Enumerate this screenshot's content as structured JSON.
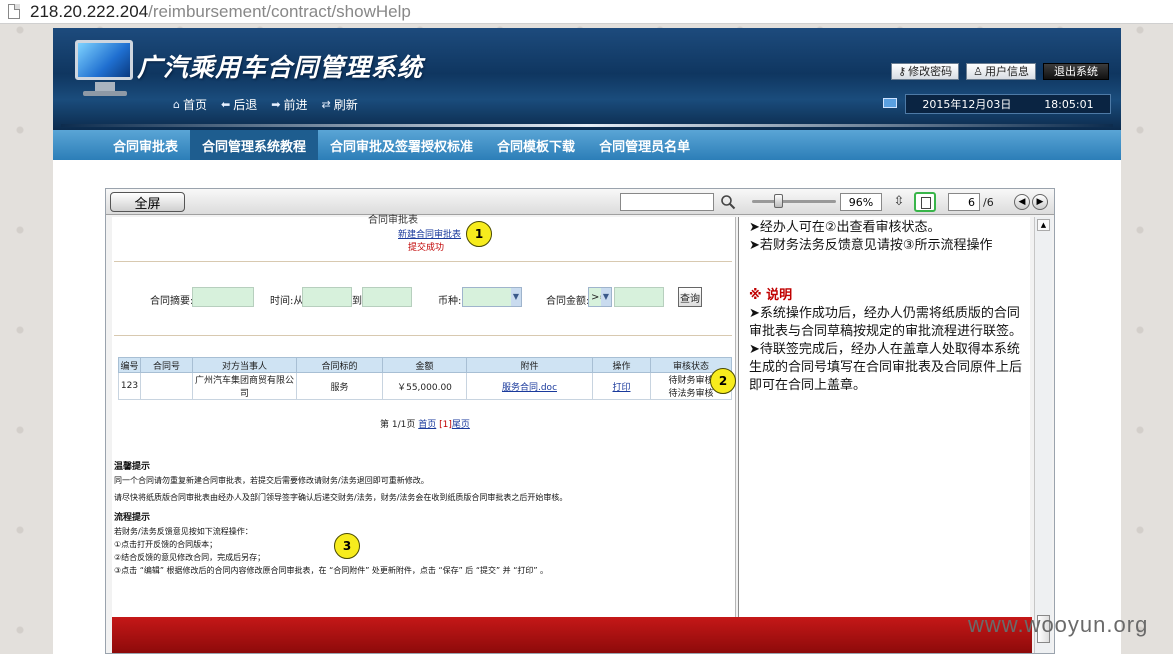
{
  "browser": {
    "url_host": "218.20.222.204",
    "url_path": "/reimbursement/contract/showHelp"
  },
  "header": {
    "title": "广汽乘用车合同管理系统",
    "actions": {
      "change_password": "修改密码",
      "user_info": "用户信息",
      "logout": "退出系统"
    },
    "nav": {
      "home": "首页",
      "back": "后退",
      "forward": "前进",
      "refresh": "刷新"
    },
    "date": "2015年12月03日",
    "time": "18:05:01"
  },
  "tabs": [
    {
      "label": "合同审批表"
    },
    {
      "label": "合同管理系统教程"
    },
    {
      "label": "合同审批及签署授权标准"
    },
    {
      "label": "合同模板下载"
    },
    {
      "label": "合同管理员名单"
    }
  ],
  "viewer": {
    "fullscreen_label": "全屏",
    "zoom": "96%",
    "page_current": "6",
    "page_total": "/6"
  },
  "doc": {
    "sub_title": "合同审批表",
    "new_link": "新建合同审批表",
    "success": "提交成功",
    "filters": {
      "summary_label": "合同摘要:",
      "time_label": "时间:从",
      "to_label": "到",
      "currency_label": "币种:",
      "amount_label": "合同金额:",
      "amount_op": ">=",
      "query_btn": "查询"
    },
    "table": {
      "headers": [
        "编号",
        "合同号",
        "对方当事人",
        "合同标的",
        "金额",
        "附件",
        "操作",
        "审核状态"
      ],
      "row": {
        "id": "123",
        "contract_no": "",
        "party": "广州汽车集团商贸有限公司",
        "subject": "服务",
        "amount": "￥55,000.00",
        "attachment": "服务合同.doc",
        "action": "打印",
        "status_1": "待财务审核",
        "status_2": "待法务审核"
      }
    },
    "pager": {
      "prefix": "第 1/1页",
      "first": "首页",
      "current": "[1]",
      "last": "尾页"
    },
    "tips": {
      "title": "温馨提示",
      "line1": "同一个合同请勿重复新建合同审批表，若提交后需要修改请财务/法务退回即可重新修改。",
      "line2": "请尽快将纸质版合同审批表由经办人及部门领导签字确认后递交财务/法务，财务/法务会在收到纸质版合同审批表之后开始审核。"
    },
    "process": {
      "title": "流程提示",
      "line1": "若财务/法务反馈意见按如下流程操作：",
      "line2": "①点击打开反馈的合同版本；",
      "line3": "②结合反馈的意见修改合同，完成后另存；",
      "line4": "③点击 “编辑” 根据修改后的合同内容修改原合同审批表，在 “合同附件” 处更新附件，点击 “保存” 后 “提交” 并 “打印” 。"
    },
    "markers": [
      "1",
      "2",
      "3"
    ]
  },
  "right_panel": {
    "p1": "➤经办人可在②出查看审核状态。",
    "p2": "➤若财务法务反馈意见请按③所示流程操作",
    "note_head": "※ 说明",
    "p3": "➤系统操作成功后，经办人仍需将纸质版的合同审批表与合同草稿按规定的审批流程进行联签。",
    "p4": "➤待联签完成后，经办人在盖章人处取得本系统生成的合同号填写在合同审批表及合同原件上后即可在合同上盖章。"
  },
  "watermark": "www.wooyun.org"
}
